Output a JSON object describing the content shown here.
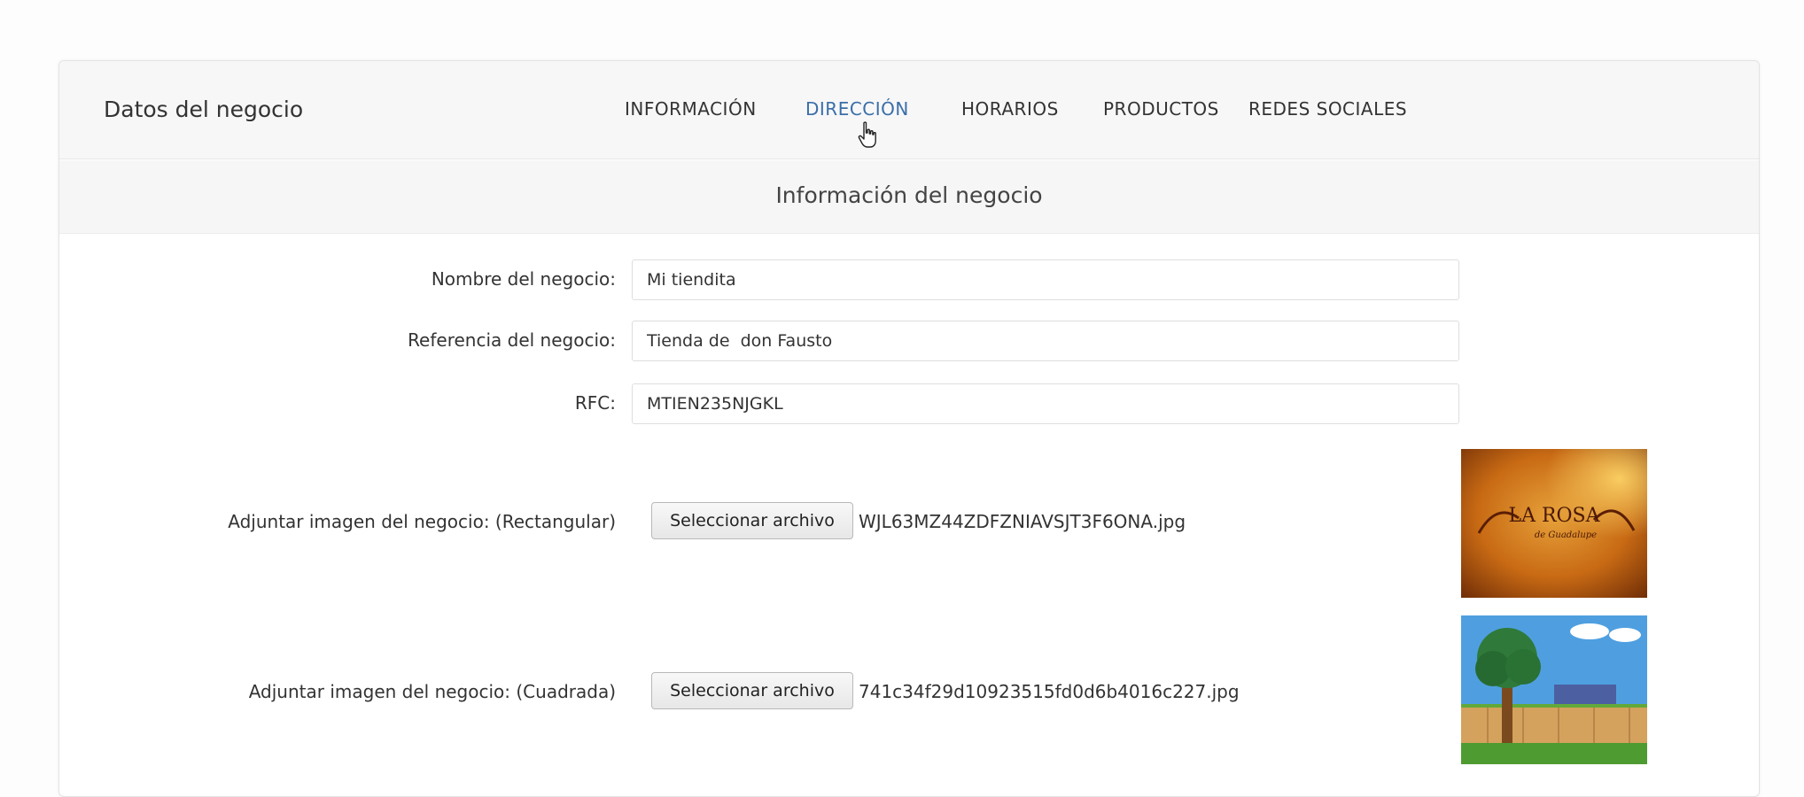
{
  "header": {
    "brand": "Datos del negocio",
    "tabs": [
      {
        "label": "INFORMACIÓN"
      },
      {
        "label": "DIRECCIÓN"
      },
      {
        "label": "HORARIOS"
      },
      {
        "label": "PRODUCTOS"
      },
      {
        "label": "REDES SOCIALES"
      }
    ],
    "active_tab": "DIRECCIÓN"
  },
  "section": {
    "title": "Información del negocio"
  },
  "form": {
    "name": {
      "label": "Nombre del negocio:",
      "value": "Mi tiendita"
    },
    "reference": {
      "label": "Referencia del negocio:",
      "value": "Tienda de  don Fausto"
    },
    "rfc": {
      "label": "RFC:",
      "value": "MTIEN235NJGKL"
    },
    "image_rect": {
      "label": "Adjuntar imagen del negocio: (Rectangular)",
      "button": "Seleccionar archivo",
      "filename": "WJL63MZ44ZDFZNIAVSJT3F6ONA.jpg",
      "preview_text": "LA ROSA",
      "preview_subtext": "de Guadalupe"
    },
    "image_square": {
      "label": "Adjuntar imagen del negocio: (Cuadrada)",
      "button": "Seleccionar archivo",
      "filename": "741c34f29d10923515fd0d6b4016c227.jpg"
    }
  },
  "colors": {
    "active_tab": "#3a6ea8",
    "bar_background": "#f7f7f7"
  }
}
